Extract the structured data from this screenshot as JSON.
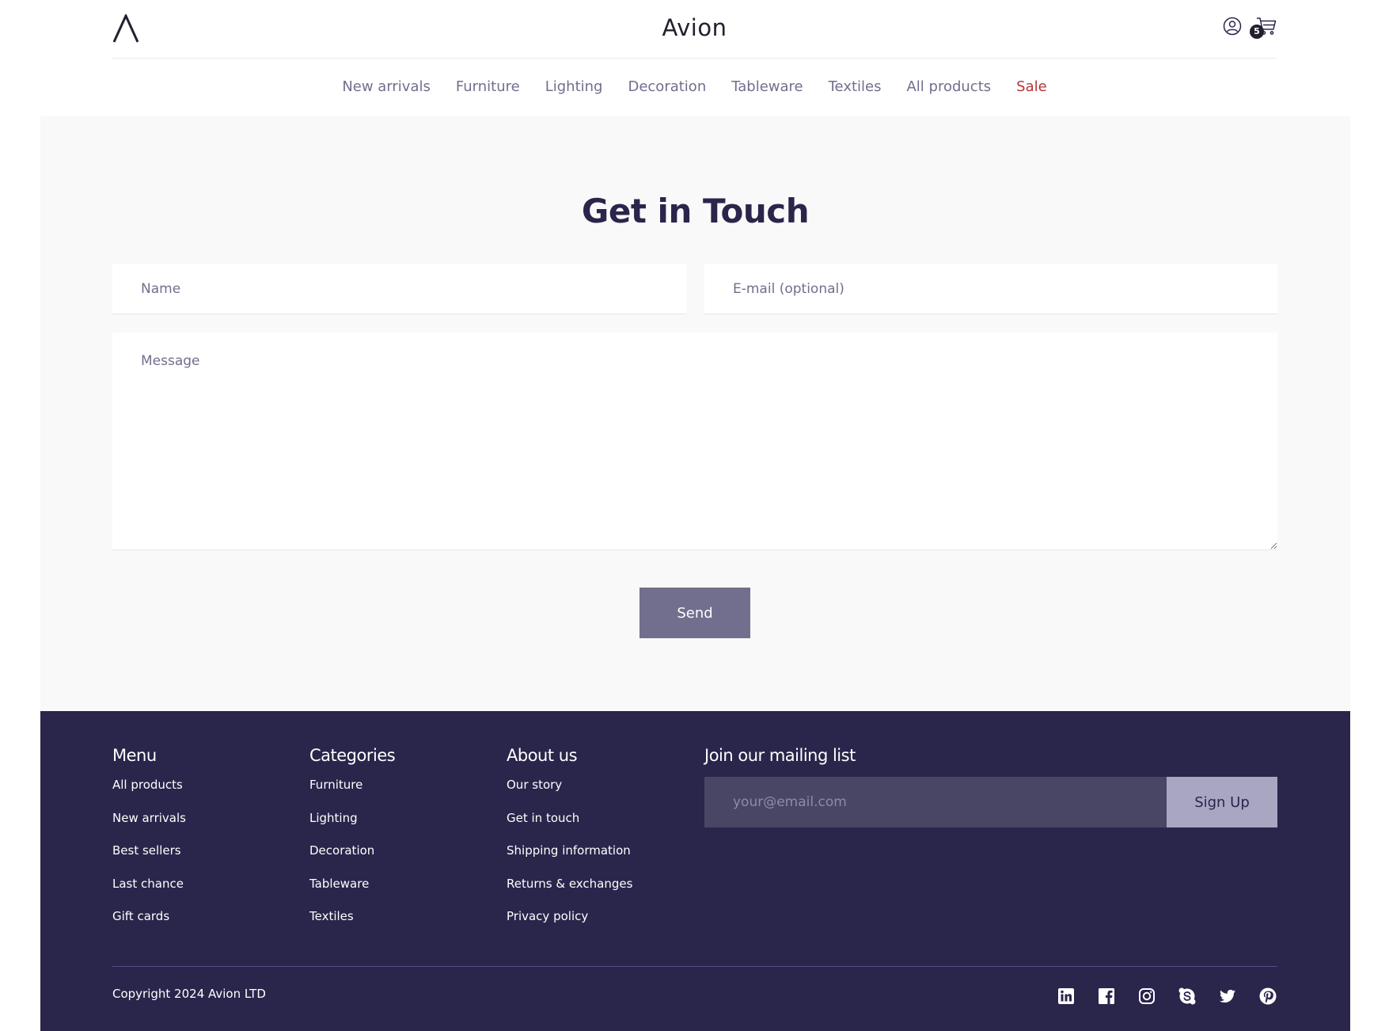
{
  "header": {
    "brand": "Avion",
    "cart_count": "5"
  },
  "nav": [
    {
      "label": "New arrivals"
    },
    {
      "label": "Furniture"
    },
    {
      "label": "Lighting"
    },
    {
      "label": "Decoration"
    },
    {
      "label": "Tableware"
    },
    {
      "label": "Textiles"
    },
    {
      "label": "All products"
    },
    {
      "label": "Sale"
    }
  ],
  "contact": {
    "title": "Get in Touch",
    "name_placeholder": "Name",
    "email_placeholder": "E-mail (optional)",
    "message_placeholder": "Message",
    "send_label": "Send"
  },
  "footer": {
    "menu": {
      "heading": "Menu",
      "items": [
        "All products",
        "New arrivals",
        "Best sellers",
        "Last chance",
        "Gift cards"
      ]
    },
    "categories": {
      "heading": "Categories",
      "items": [
        "Furniture",
        "Lighting",
        "Decoration",
        "Tableware",
        "Textiles"
      ]
    },
    "about": {
      "heading": "About us",
      "items": [
        "Our story",
        "Get in touch",
        "Shipping information",
        "Returns & exchanges",
        "Privacy policy"
      ]
    },
    "mailing": {
      "heading": "Join our mailing list",
      "placeholder": "your@email.com",
      "button_label": "Sign Up"
    },
    "copyright": "Copyright 2024 Avion LTD",
    "social": [
      "linkedin-icon",
      "facebook-icon",
      "instagram-icon",
      "skype-icon",
      "twitter-icon",
      "pinterest-icon"
    ]
  },
  "colors": {
    "primary": "#2A254B",
    "muted": "#726E8D",
    "sale": "#B83434",
    "background_light": "#F9F9F9",
    "signup_button": "#A9A6C2"
  }
}
